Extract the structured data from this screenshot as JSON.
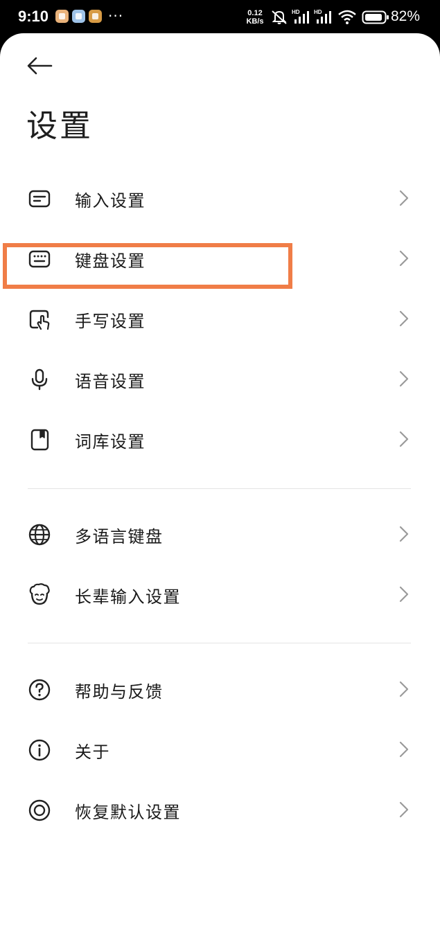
{
  "status_bar": {
    "time": "9:10",
    "more": "···",
    "net_speed_value": "0.12",
    "net_speed_unit": "KB/s",
    "battery_percent": "82%"
  },
  "header": {
    "back_icon": "arrow-left-icon",
    "title": "设置"
  },
  "menu_groups": [
    {
      "items": [
        {
          "label": "输入设置",
          "icon": "input-box-icon"
        },
        {
          "label": "键盘设置",
          "icon": "keyboard-icon",
          "highlighted": true
        },
        {
          "label": "手写设置",
          "icon": "handwriting-icon"
        },
        {
          "label": "语音设置",
          "icon": "microphone-icon"
        },
        {
          "label": "词库设置",
          "icon": "dictionary-icon"
        }
      ]
    },
    {
      "items": [
        {
          "label": "多语言键盘",
          "icon": "globe-icon"
        },
        {
          "label": "长辈输入设置",
          "icon": "elder-face-icon"
        }
      ]
    },
    {
      "items": [
        {
          "label": "帮助与反馈",
          "icon": "help-icon"
        },
        {
          "label": "关于",
          "icon": "info-icon"
        },
        {
          "label": "恢复默认设置",
          "icon": "restore-icon"
        }
      ]
    }
  ],
  "colors": {
    "highlight": "#f07d47",
    "text": "#1a1a1a",
    "chevron": "#9a9a9a",
    "divider": "#e4e4e4"
  }
}
